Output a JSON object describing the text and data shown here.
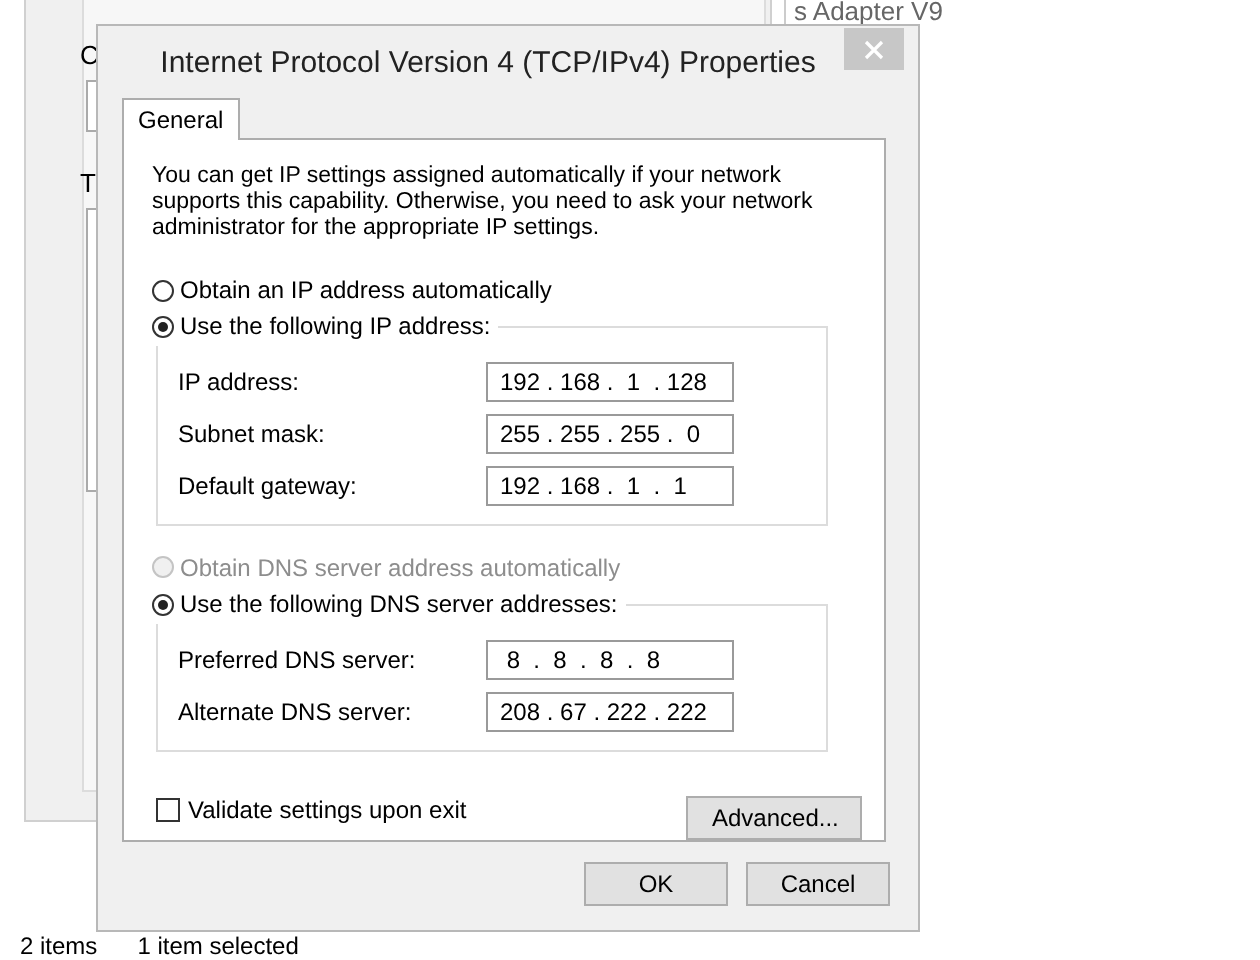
{
  "background_window": {
    "labels": [
      "C",
      "T"
    ],
    "adapter_text": "s Adapter V9",
    "status_bar": [
      "2 items",
      "1 item selected"
    ]
  },
  "dialog": {
    "title": "Internet Protocol Version 4 (TCP/IPv4) Properties",
    "tabs": [
      {
        "label": "General",
        "selected": true
      }
    ],
    "description": "You can get IP settings assigned automatically if your network supports this capability. Otherwise, you need to ask your network administrator for the appropriate IP settings.",
    "ip": {
      "options": [
        {
          "label": "Obtain an IP address automatically",
          "selected": false,
          "disabled": false
        },
        {
          "label": "Use the following IP address:",
          "selected": true,
          "disabled": false
        }
      ],
      "fields": [
        {
          "label": "IP address:",
          "value": "192 . 168 .  1  . 128"
        },
        {
          "label": "Subnet mask:",
          "value": "255 . 255 . 255 .  0"
        },
        {
          "label": "Default gateway:",
          "value": "192 . 168 .  1  .  1"
        }
      ]
    },
    "dns": {
      "options": [
        {
          "label": "Obtain DNS server address automatically",
          "selected": false,
          "disabled": true
        },
        {
          "label": "Use the following DNS server addresses:",
          "selected": true,
          "disabled": false
        }
      ],
      "fields": [
        {
          "label": "Preferred DNS server:",
          "value": " 8  .  8  .  8  .  8"
        },
        {
          "label": "Alternate DNS server:",
          "value": "208 . 67 . 222 . 222"
        }
      ]
    },
    "validate": {
      "label": "Validate settings upon exit",
      "checked": false
    },
    "advanced_button": "Advanced...",
    "buttons": [
      "OK",
      "Cancel"
    ]
  }
}
